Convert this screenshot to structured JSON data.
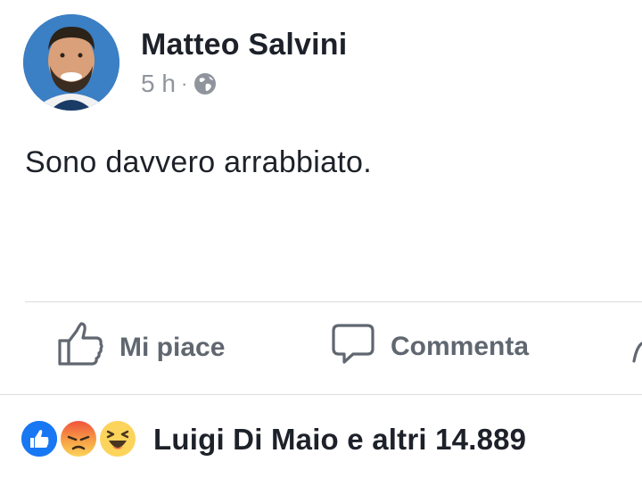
{
  "post": {
    "author": "Matteo Salvini",
    "time": "5 h",
    "separator": "·",
    "privacy_icon": "globe-icon",
    "text": "Sono davvero arrabbiato."
  },
  "actions": {
    "like_label": "Mi piace",
    "comment_label": "Commenta",
    "like_icon": "thumbs-up-icon",
    "comment_icon": "speech-bubble-icon",
    "share_icon": "share-arrow-icon"
  },
  "reactions": {
    "icons": [
      "like-reaction-icon",
      "angry-reaction-icon",
      "haha-reaction-icon"
    ],
    "summary": "Luigi Di Maio e altri 14.889"
  },
  "colors": {
    "like_blue": "#1877f2",
    "muted_text": "#606770",
    "divider": "#dadde1"
  }
}
